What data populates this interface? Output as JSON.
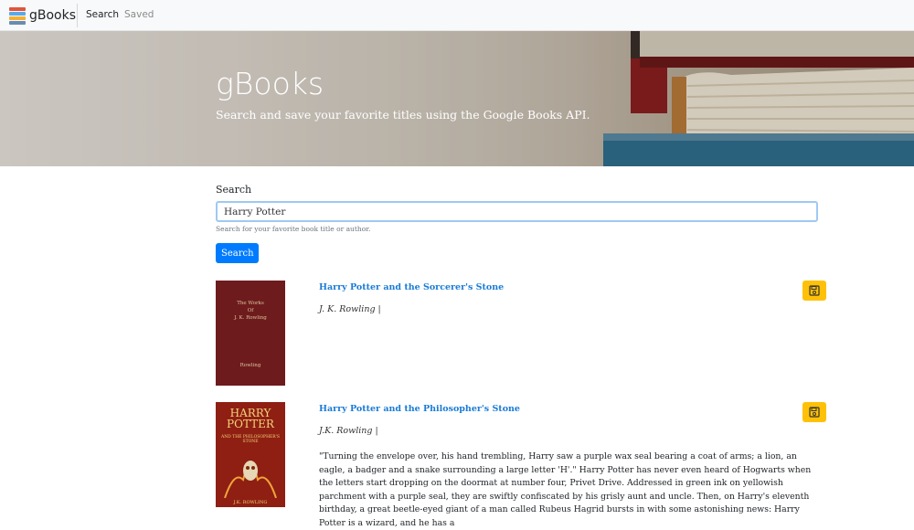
{
  "nav": {
    "brand": "gBooks",
    "links": [
      "Search",
      "Saved"
    ]
  },
  "hero": {
    "title": "gBooks",
    "subtitle": "Search and save your favorite titles using the Google Books API."
  },
  "search": {
    "label": "Search",
    "value": "Harry Potter",
    "help": "Search for your favorite book title or author.",
    "button": "Search"
  },
  "results": [
    {
      "title": "Harry Potter and the Sorcerer's Stone",
      "author": "J. K. Rowling |",
      "cover_lines": [
        "The Works",
        "Of",
        "J. K. Rowling"
      ],
      "cover_footer": "Rowling"
    },
    {
      "title": "Harry Potter and the Philosopher's Stone",
      "author": "J.K. Rowling |",
      "cover_title": "HARRY POTTER",
      "cover_subtitle": "AND THE PHILOSOPHER'S STONE",
      "cover_author": "J.K. ROWLING",
      "description": "\"Turning the envelope over, his hand trembling, Harry saw a purple wax seal bearing a coat of arms; a lion, an eagle, a badger and a snake surrounding a large letter 'H'.\" Harry Potter has never even heard of Hogwarts when the letters start dropping on the doormat at number four, Privet Drive. Addressed in green ink on yellowish parchment with a purple seal, they are swiftly confiscated by his grisly aunt and uncle. Then, on Harry's eleventh birthday, a great beetle-eyed giant of a man called Rubeus Hagrid bursts in with some astonishing news: Harry Potter is a wizard, and he has a"
    }
  ],
  "colors": {
    "primary": "#007bff",
    "save": "#ffc107",
    "link": "#1a7bd6"
  }
}
